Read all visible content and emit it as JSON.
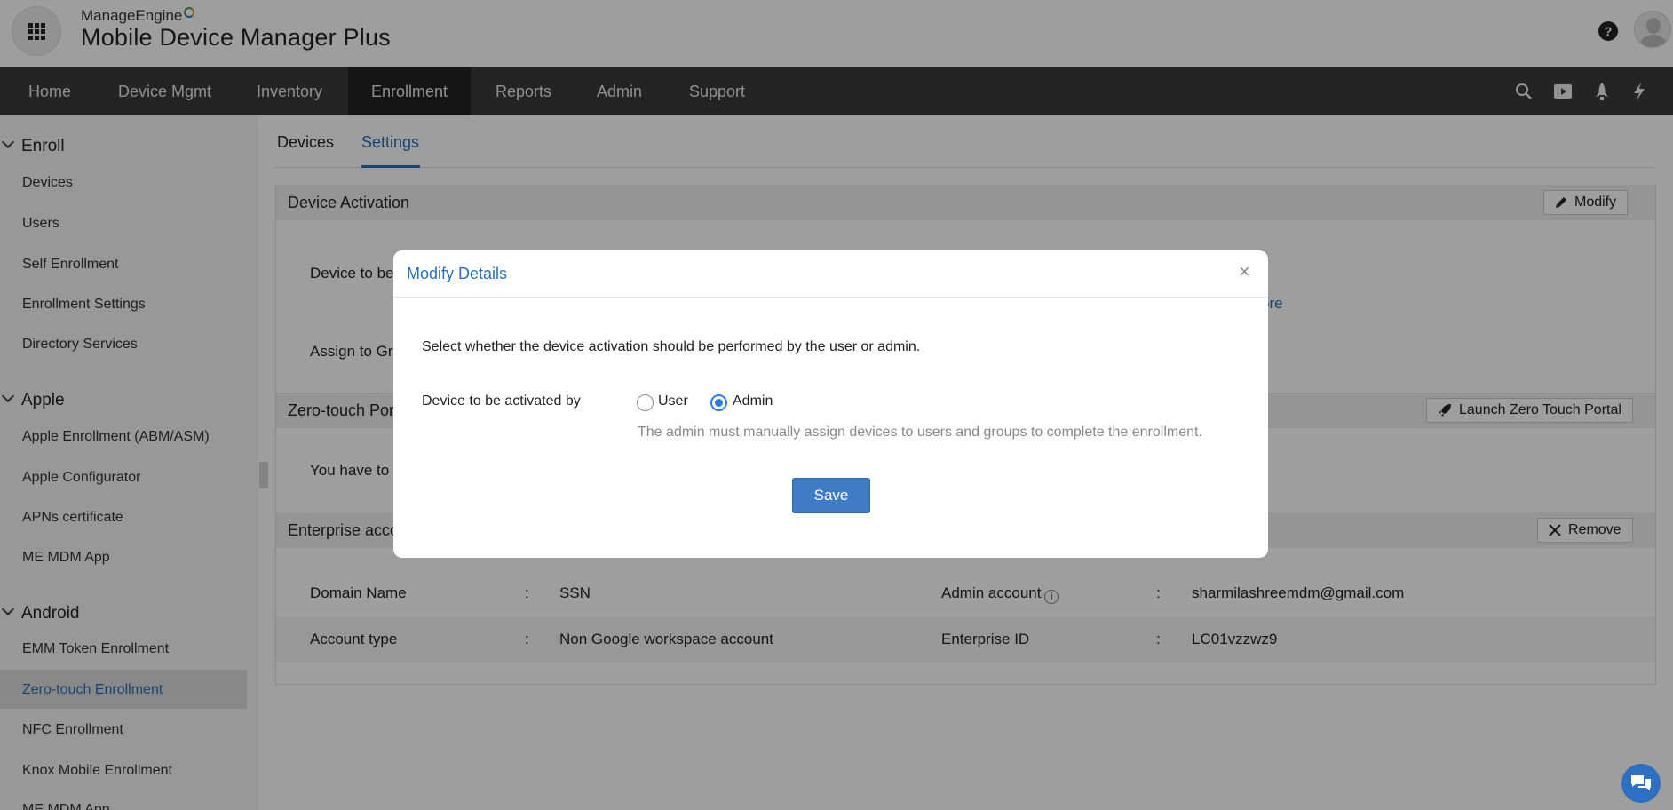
{
  "header": {
    "brand_small": "ManageEngine",
    "brand_big": "Mobile Device Manager Plus",
    "help_glyph": "?"
  },
  "nav": {
    "items": [
      "Home",
      "Device Mgmt",
      "Inventory",
      "Enrollment",
      "Reports",
      "Admin",
      "Support"
    ],
    "active": "Enrollment",
    "right_icons": [
      "search-icon",
      "video-icon",
      "rocket-icon",
      "lightning-icon"
    ]
  },
  "sidebar": {
    "sections": [
      {
        "title": "Enroll",
        "items": [
          "Devices",
          "Users",
          "Self Enrollment",
          "Enrollment Settings",
          "Directory Services"
        ]
      },
      {
        "title": "Apple",
        "items": [
          "Apple Enrollment (ABM/ASM)",
          "Apple Configurator",
          "APNs certificate",
          "ME MDM App"
        ]
      },
      {
        "title": "Android",
        "items": [
          "EMM Token Enrollment",
          "Zero-touch Enrollment",
          "NFC Enrollment",
          "Knox Mobile Enrollment",
          "ME MDM App"
        ]
      }
    ],
    "active_item": "Zero-touch Enrollment"
  },
  "tabs": [
    "Devices",
    "Settings"
  ],
  "active_tab": "Settings",
  "panels": {
    "device_activation": {
      "title": "Device Activation",
      "button": "Modify",
      "row1_label": "Device to be",
      "row2_label": "Assign to Gro",
      "more_link": "ore"
    },
    "zero_touch": {
      "title": "Zero-touch Por",
      "button": "Launch Zero Touch Portal",
      "row_text": "You have to li"
    },
    "enterprise": {
      "title": "Enterprise acco",
      "button": "Remove",
      "rows": [
        {
          "k1": "Domain Name",
          "v1": "SSN",
          "k2": "Admin account",
          "v2": "sharmilashreemdm@gmail.com"
        },
        {
          "k1": "Account type",
          "v1": "Non Google workspace account",
          "k2": "Enterprise ID",
          "v2": "LC01vzzwz9"
        }
      ],
      "separator": ":"
    }
  },
  "modal": {
    "title": "Modify Details",
    "close_glyph": "×",
    "description": "Select whether the device activation should be performed by the user or admin.",
    "field_label": "Device to be activated by",
    "options": [
      "User",
      "Admin"
    ],
    "selected": "Admin",
    "hint": "The admin must manually assign devices to users and groups to complete the enrollment.",
    "save_label": "Save"
  },
  "colors": {
    "accent": "#2c6fb5",
    "nav_bg": "#3a3a3a",
    "nav_active": "#222222",
    "save_btn": "#3f7cc4"
  }
}
